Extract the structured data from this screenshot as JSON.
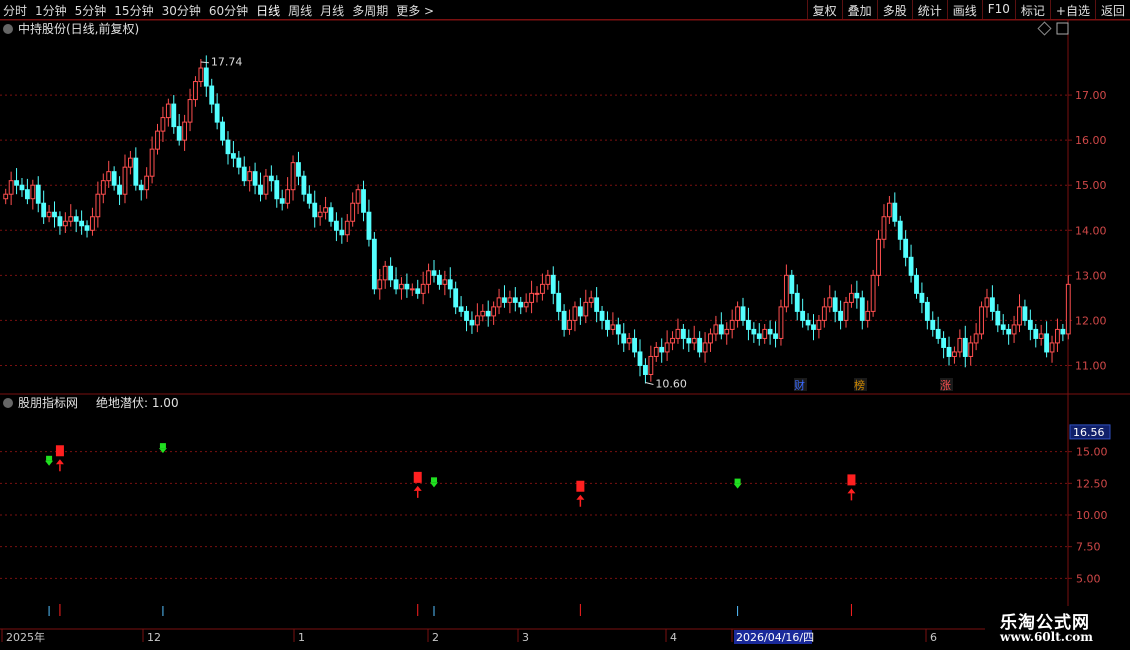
{
  "toolbar": {
    "periods": [
      "分时",
      "1分钟",
      "5分钟",
      "15分钟",
      "30分钟",
      "60分钟",
      "日线",
      "周线",
      "月线",
      "多周期",
      "更多 >"
    ],
    "active_index": 6,
    "buttons": [
      "复权",
      "叠加",
      "多股",
      "统计",
      "画线",
      "F10",
      "标记",
      "+自选",
      "返回"
    ]
  },
  "main_panel": {
    "title": "中持股份(日线,前复权)",
    "high_label": "17.74",
    "low_label": "10.60",
    "event_markers": [
      "财",
      "榜",
      "涨"
    ]
  },
  "indicator_panel": {
    "title": "股朋指标网",
    "indicator": "绝地潜伏: 1.00",
    "value_box": "16.56"
  },
  "date_axis": {
    "labels": [
      "2025年",
      "12",
      "1",
      "2",
      "3",
      "4",
      "2026/04/16/四",
      "6"
    ]
  },
  "watermark": {
    "line1": "乐淘公式网",
    "line2": "www.60lt.com"
  },
  "colors": {
    "up": "#ff4f4f",
    "down": "#54ffff",
    "grid": "#7a1010",
    "signal_red": "#ff2020",
    "signal_green": "#20e020"
  },
  "chart_data": [
    {
      "type": "candlestick",
      "title": "中持股份(日线,前复权)",
      "ylim": [
        10.5,
        18.0
      ],
      "y_ticks": [
        11.0,
        12.0,
        13.0,
        14.0,
        15.0,
        16.0,
        17.0
      ],
      "y_tick_labels": [
        "11.00",
        "12.00",
        "13.00",
        "14.00",
        "15.00",
        "16.00",
        "17.00"
      ],
      "grid": true,
      "annotations": [
        {
          "label": "17.74",
          "value": 17.74
        },
        {
          "label": "10.60",
          "value": 10.6
        }
      ],
      "close_series": [
        14.8,
        15.1,
        15.0,
        14.9,
        14.7,
        15.0,
        14.6,
        14.3,
        14.4,
        14.3,
        14.1,
        14.2,
        14.3,
        14.2,
        14.1,
        14.0,
        14.3,
        14.8,
        15.1,
        15.3,
        15.0,
        14.8,
        15.4,
        15.6,
        15.0,
        14.9,
        15.2,
        15.8,
        16.2,
        16.5,
        16.8,
        16.3,
        16.0,
        16.4,
        16.9,
        17.3,
        17.6,
        17.2,
        16.8,
        16.4,
        16.0,
        15.7,
        15.6,
        15.4,
        15.1,
        15.3,
        15.0,
        14.8,
        15.2,
        15.1,
        14.7,
        14.6,
        14.9,
        15.5,
        15.2,
        14.8,
        14.6,
        14.3,
        14.4,
        14.5,
        14.2,
        14.0,
        13.9,
        14.2,
        14.6,
        14.9,
        14.4,
        13.8,
        12.7,
        12.9,
        13.2,
        12.9,
        12.7,
        12.8,
        12.7,
        12.7,
        12.6,
        12.8,
        13.1,
        13.0,
        12.8,
        12.9,
        12.7,
        12.3,
        12.2,
        12.0,
        11.9,
        12.1,
        12.2,
        12.1,
        12.3,
        12.5,
        12.4,
        12.5,
        12.4,
        12.3,
        12.4,
        12.6,
        12.6,
        12.8,
        13.0,
        12.6,
        12.2,
        11.8,
        12.0,
        12.3,
        12.1,
        12.4,
        12.5,
        12.2,
        12.0,
        11.8,
        11.9,
        11.7,
        11.5,
        11.6,
        11.3,
        11.0,
        10.8,
        11.2,
        11.4,
        11.3,
        11.5,
        11.6,
        11.8,
        11.6,
        11.5,
        11.6,
        11.3,
        11.5,
        11.7,
        11.9,
        11.7,
        11.8,
        12.0,
        12.3,
        12.0,
        11.8,
        11.7,
        11.6,
        11.8,
        11.7,
        11.6,
        12.3,
        13.0,
        12.6,
        12.2,
        12.0,
        11.9,
        11.8,
        12.0,
        12.3,
        12.5,
        12.2,
        12.0,
        12.4,
        12.6,
        12.5,
        12.0,
        12.2,
        13.0,
        13.8,
        14.3,
        14.6,
        14.2,
        13.8,
        13.4,
        13.0,
        12.6,
        12.4,
        12.0,
        11.8,
        11.6,
        11.4,
        11.2,
        11.3,
        11.6,
        11.2,
        11.5,
        11.7,
        12.3,
        12.5,
        12.2,
        11.9,
        11.8,
        11.7,
        11.9,
        12.3,
        12.0,
        11.8,
        11.6,
        11.7,
        11.3,
        11.5,
        11.8,
        11.7,
        12.8
      ],
      "series": [
        {
          "values": "close_series"
        }
      ]
    },
    {
      "type": "scatter",
      "title": "绝地潜伏",
      "ylim": [
        2.5,
        17.5
      ],
      "y_ticks": [
        5.0,
        7.5,
        10.0,
        12.5,
        15.0
      ],
      "y_tick_labels": [
        "5.00",
        "7.50",
        "10.00",
        "12.50",
        "15.00"
      ],
      "current_value": 16.56,
      "signals": [
        {
          "bar": 8,
          "kind": "green_down",
          "value": 14.2
        },
        {
          "bar": 10,
          "kind": "red_up",
          "value": 14.4
        },
        {
          "bar": 29,
          "kind": "green_down",
          "value": 15.2
        },
        {
          "bar": 76,
          "kind": "red_up",
          "value": 12.3
        },
        {
          "bar": 79,
          "kind": "green_down",
          "value": 12.5
        },
        {
          "bar": 106,
          "kind": "red_up",
          "value": 11.6
        },
        {
          "bar": 135,
          "kind": "green_down",
          "value": 12.4
        },
        {
          "bar": 156,
          "kind": "red_up",
          "value": 12.1
        }
      ]
    }
  ]
}
